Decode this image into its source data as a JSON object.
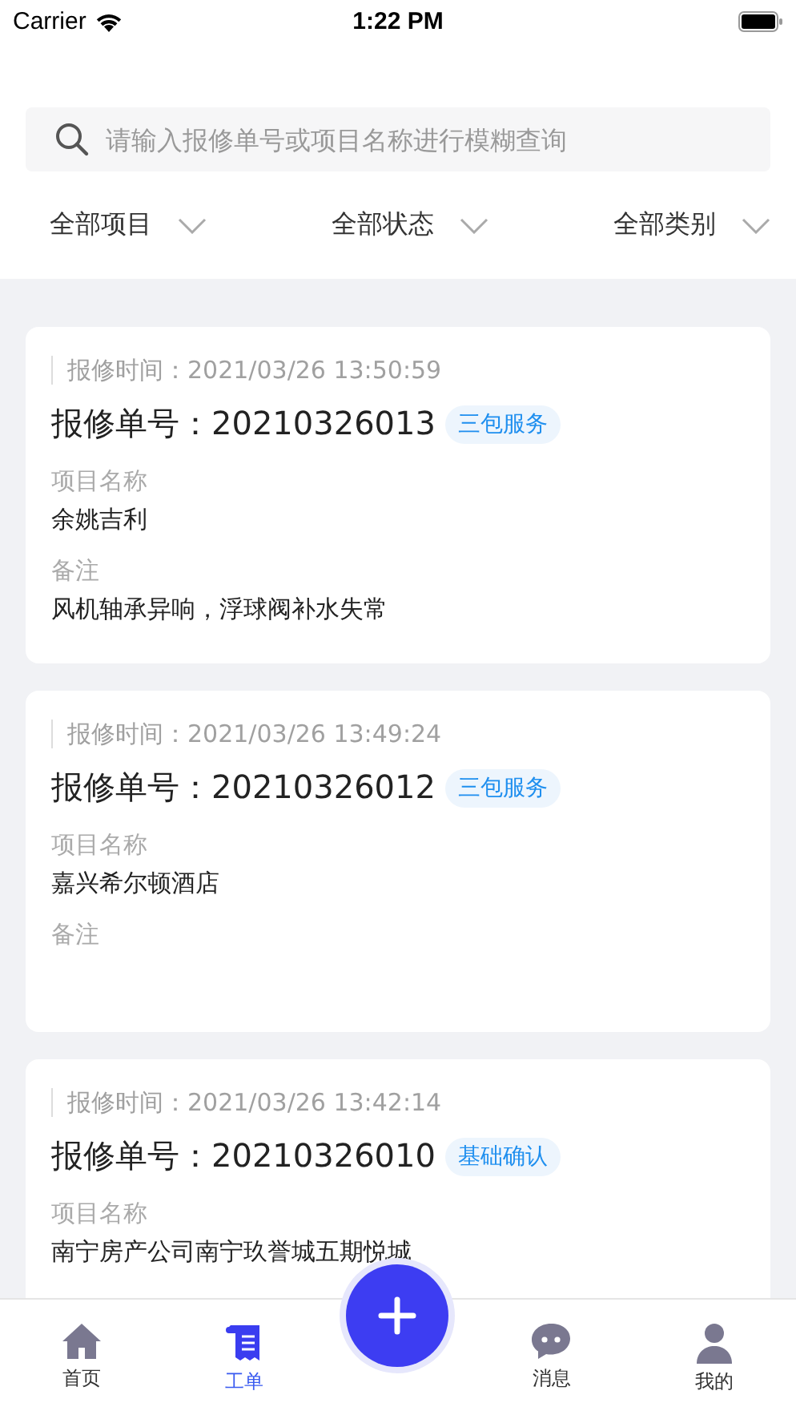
{
  "status_bar": {
    "carrier": "Carrier",
    "time": "1:22 PM"
  },
  "search": {
    "placeholder": "请输入报修单号或项目名称进行模糊查询"
  },
  "filters": [
    {
      "label": "全部项目"
    },
    {
      "label": "全部状态"
    },
    {
      "label": "全部类别"
    }
  ],
  "orders": [
    {
      "time_label": "报修时间：",
      "time": "2021/03/26 13:50:59",
      "number_label": "报修单号：",
      "number": "20210326013",
      "tag": "三包服务",
      "project_label": "项目名称",
      "project": "余姚吉利",
      "remark_label": "备注",
      "remark": "风机轴承异响，浮球阀补水失常"
    },
    {
      "time_label": "报修时间：",
      "time": "2021/03/26 13:49:24",
      "number_label": "报修单号：",
      "number": "20210326012",
      "tag": "三包服务",
      "project_label": "项目名称",
      "project": "嘉兴希尔顿酒店",
      "remark_label": "备注"
    },
    {
      "time_label": "报修时间：",
      "time": "2021/03/26 13:42:14",
      "number_label": "报修单号：",
      "number": "20210326010",
      "tag": "基础确认",
      "project_label": "项目名称",
      "project": "南宁房产公司南宁玖誉城五期悦城"
    }
  ],
  "tabs": [
    {
      "kind": "home",
      "label": "首页",
      "selected": false
    },
    {
      "kind": "orders",
      "label": "工单",
      "selected": true
    },
    {
      "kind": "add"
    },
    {
      "kind": "messages",
      "label": "消息",
      "selected": false
    },
    {
      "kind": "profile",
      "label": "我的",
      "selected": false
    }
  ]
}
